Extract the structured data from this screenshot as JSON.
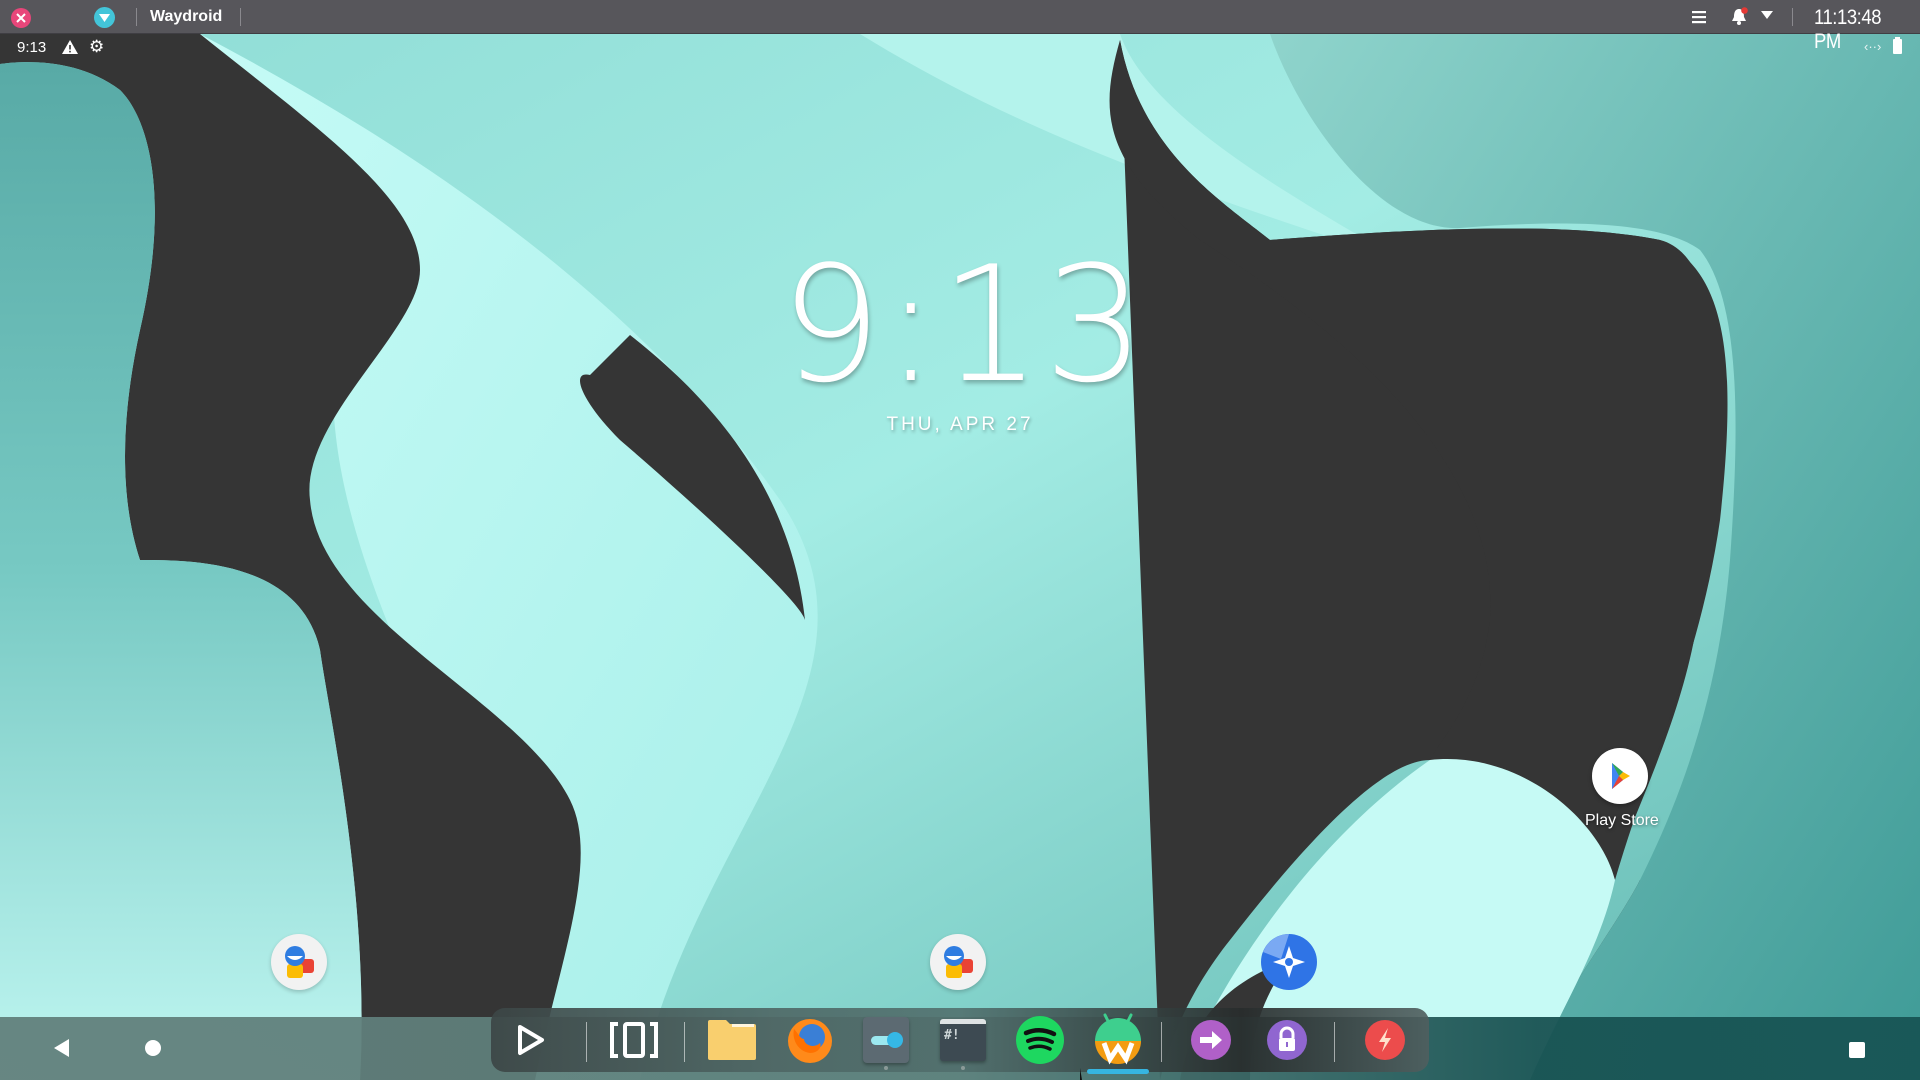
{
  "host_panel": {
    "close_icon": "close-icon",
    "app_icon": "waydroid-icon",
    "title": "Waydroid",
    "menu_icon": "hamburger-menu-icon",
    "notification_icon": "bell-icon",
    "notification_badge_color": "#e53935",
    "dropdown_icon": "caret-down-icon",
    "clock": "11:13:48 PM"
  },
  "status_bar": {
    "time": "9:13",
    "icons": [
      "warning-icon",
      "gear-icon"
    ],
    "right_icons": [
      "data-transfer-icon",
      "battery-icon"
    ]
  },
  "clock_widget": {
    "time": "9:13",
    "date": "THU, APR 27"
  },
  "desktop": {
    "icons": [
      {
        "name": "play-store",
        "label": "Play Store"
      },
      {
        "name": "contacts-app-left",
        "label": ""
      },
      {
        "name": "contacts-app-center",
        "label": ""
      },
      {
        "name": "maps-compass-app",
        "label": ""
      }
    ]
  },
  "dock": {
    "items": [
      {
        "name": "launcher",
        "icon": "play-outline-icon"
      },
      {
        "name": "workspaces",
        "icon": "bracket-zero-icon"
      },
      {
        "name": "files",
        "icon": "folder-icon"
      },
      {
        "name": "firefox",
        "icon": "firefox-icon"
      },
      {
        "name": "settings-toggle",
        "icon": "toggle-icon",
        "running": true
      },
      {
        "name": "terminal",
        "icon": "terminal-icon",
        "running": true,
        "glyph": "#!"
      },
      {
        "name": "spotify",
        "icon": "spotify-icon"
      },
      {
        "name": "waydroid",
        "icon": "waydroid-android-icon",
        "active": true
      },
      {
        "name": "logout",
        "icon": "arrow-right-icon"
      },
      {
        "name": "lock",
        "icon": "lock-icon"
      },
      {
        "name": "power",
        "icon": "lightning-icon"
      }
    ],
    "colors": {
      "active_indicator": "#36b5e0",
      "spotify": "#1ed760",
      "logout": "#b060c8",
      "lock": "#9066d0",
      "power": "#ec4c4c",
      "folder": "#fad27a",
      "firefox": "#ff8a1a"
    }
  },
  "nav_bar": {
    "back_icon": "back-triangle-icon",
    "home_icon": "home-circle-icon",
    "recents_icon": "recents-square-icon"
  }
}
